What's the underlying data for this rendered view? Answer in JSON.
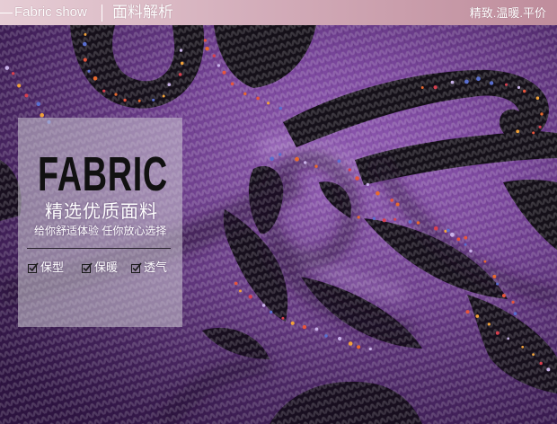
{
  "header": {
    "title_en": "Fabric show",
    "title_cn": "面料解析",
    "tagline": "精致.温暖.平价"
  },
  "overlay": {
    "heading": "FABRIC",
    "subheading": "精选优质面料",
    "slogan": "给你舒适体验 任你放心选择",
    "features": [
      {
        "label": "保型",
        "icon": "checkbox-checked-icon"
      },
      {
        "label": "保暖",
        "icon": "checkbox-checked-icon"
      },
      {
        "label": "透气",
        "icon": "checkbox-checked-icon"
      }
    ]
  },
  "colors": {
    "header_start": "#e6cdd5",
    "header_end": "#bf8d9c",
    "fabric_purple": "#7a469c",
    "pattern_black": "#151019"
  }
}
